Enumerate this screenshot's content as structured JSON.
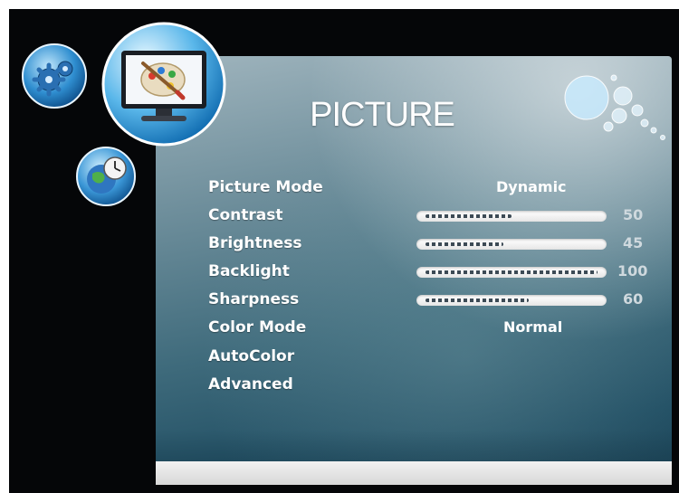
{
  "menu": {
    "title": "PICTURE",
    "items": [
      {
        "label": "Picture Mode",
        "value": "Dynamic"
      },
      {
        "label": "Contrast",
        "slider": 0.5,
        "number": "50"
      },
      {
        "label": "Brightness",
        "slider": 0.45,
        "number": "45"
      },
      {
        "label": "Backlight",
        "slider": 1.0,
        "number": "100"
      },
      {
        "label": "Sharpness",
        "slider": 0.6,
        "number": "60"
      },
      {
        "label": "Color Mode",
        "value": "Normal"
      },
      {
        "label": "AutoColor"
      },
      {
        "label": "Advanced"
      }
    ]
  },
  "icons": {
    "setup": "gear-icon",
    "picture": "monitor-palette-icon",
    "time": "globe-clock-icon",
    "decoration": "bubbles-icon"
  },
  "colors": {
    "panel_top": "#9fb4bd",
    "panel_bottom": "#183f52",
    "text": "#ffffff",
    "slider_track": "#ffffff"
  }
}
